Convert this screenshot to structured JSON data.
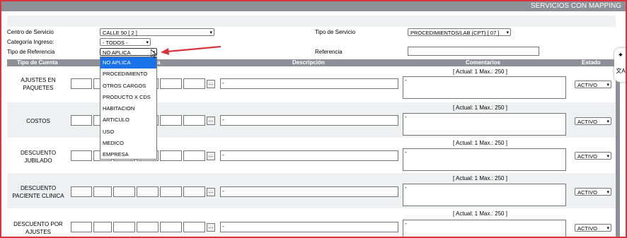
{
  "app_title": "SERVICIOS CON MAPPING",
  "form": {
    "centro_label": "Centro de Servicio",
    "centro_value": "CALLE 50 [ 2 ]",
    "categoria_label": "Categoría Ingreso:",
    "categoria_value": "- TODOS -",
    "tipo_ref_label": "Tipo de Referencia",
    "tipo_ref_value": "NO APLICA",
    "tipo_serv_label": "Tipo de Servicio",
    "tipo_serv_value": "PROCEDIMIENTOS/LAB (CPT) [ 07 ]",
    "referencia_label": "Referencia",
    "referencia_value": ""
  },
  "table": {
    "headers": {
      "tipo_cuenta": "Tipo de Cuenta",
      "cuenta_fragment": "a",
      "descripcion": "Descripción",
      "comentarios": "Comentarios",
      "estado": "Estado"
    },
    "limit_text": "[ Actual: 1   Max.: 250 ]",
    "dots_label": "...",
    "rows": [
      {
        "name": "AJUSTES EN PAQUETES",
        "desc": "-",
        "comment": "-",
        "estado": "ACTIVO"
      },
      {
        "name": "COSTOS",
        "desc": "-",
        "comment": "-",
        "estado": "ACTIVO"
      },
      {
        "name": "DESCUENTO JUBILADO",
        "desc": "-",
        "comment": "-",
        "estado": "ACTIVO"
      },
      {
        "name": "DESCUENTO PACIENTE CLINICA",
        "desc": "-",
        "comment": "-",
        "estado": "ACTIVO"
      },
      {
        "name": "DESCUENTO POR AJUSTES",
        "desc": "-",
        "comment": "-",
        "estado": "ACTIVO"
      }
    ]
  },
  "dropdown_options": [
    "NO APLICA",
    "PROCEDIMIENTO",
    "OTROS CARGOS",
    "PRODUCTO X CDS",
    "HABITACION",
    "ARTICULO",
    "USO",
    "MEDICO",
    "EMPRESA"
  ],
  "side_icons": {
    "sparkle": "✦",
    "translate": "文A"
  },
  "colors": {
    "accent": "#1a73e8",
    "header_gray": "#8d9197",
    "frame_red": "#d9343e",
    "annotation_arrow": "#d9343e"
  }
}
